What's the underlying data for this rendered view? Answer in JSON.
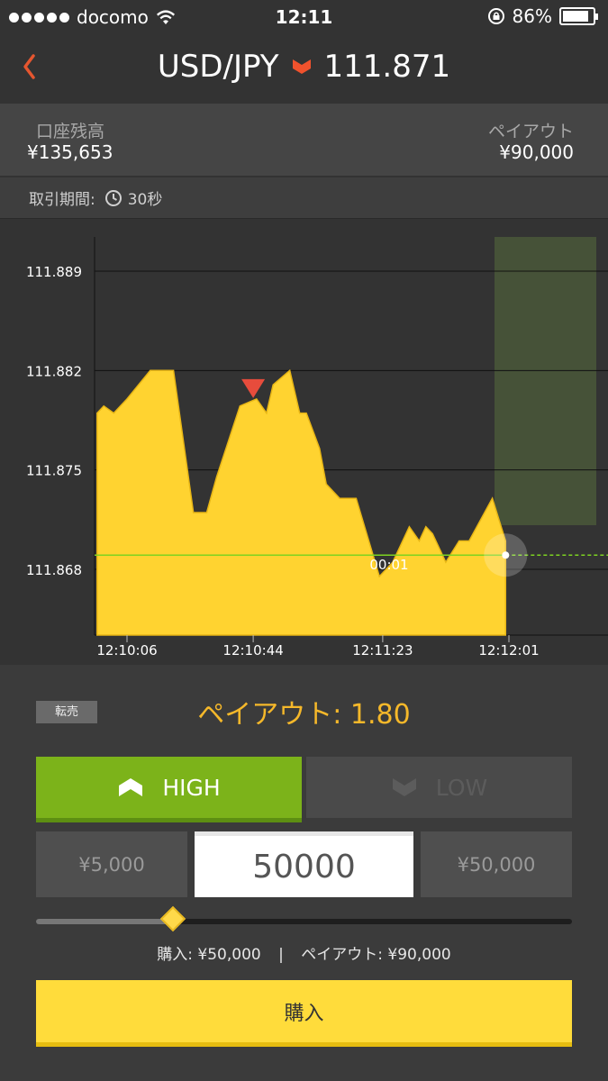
{
  "status_bar": {
    "carrier": "docomo",
    "time": "12:11",
    "battery": "86%",
    "battery_level": 0.86
  },
  "header": {
    "pair": "USD/JPY",
    "price": "111.871",
    "direction": "down",
    "direction_color": "#f0522d"
  },
  "account": {
    "balance_label": "口座残高",
    "balance_value": "¥135,653",
    "payout_label": "ペイアウト",
    "payout_value": "¥90,000"
  },
  "period": {
    "label": "取引期間:",
    "value": "30秒"
  },
  "chart_data": {
    "type": "area",
    "y_ticks": [
      "111.889",
      "111.882",
      "111.875",
      "111.868"
    ],
    "x_ticks": [
      "12:10:06",
      "12:10:44",
      "12:11:23",
      "12:12:01"
    ],
    "ylim": [
      111.8635,
      111.8905
    ],
    "x": [
      "12:09:57",
      "12:09:59",
      "12:10:02",
      "12:10:04",
      "12:10:06",
      "12:10:13",
      "12:10:15",
      "12:10:20",
      "12:10:26",
      "12:10:30",
      "12:10:33",
      "12:10:40",
      "12:10:45",
      "12:10:48",
      "12:10:50",
      "12:10:55",
      "12:10:58",
      "12:11:00",
      "12:11:04",
      "12:11:06",
      "12:11:10",
      "12:11:12",
      "12:11:15",
      "12:11:22",
      "12:11:26",
      "12:11:31",
      "12:11:34",
      "12:11:36",
      "12:11:38",
      "12:11:42",
      "12:11:46",
      "12:11:49",
      "12:11:56",
      "12:12:00"
    ],
    "values": [
      111.879,
      111.8795,
      111.879,
      111.8795,
      111.88,
      111.882,
      111.882,
      111.882,
      111.872,
      111.872,
      111.8745,
      111.8795,
      111.88,
      111.879,
      111.881,
      111.882,
      111.879,
      111.879,
      111.8765,
      111.874,
      111.873,
      111.873,
      111.873,
      111.8675,
      111.8685,
      111.871,
      111.87,
      111.871,
      111.8705,
      111.8685,
      111.87,
      111.87,
      111.873,
      111.87
    ],
    "strike": 111.869,
    "expiry_label": "00:01",
    "entry_marker_x": "12:10:44",
    "entry_marker_value": 111.88,
    "area_color": "#ffd330",
    "marker_color": "#e74c3c",
    "strike_color": "#7ed321",
    "expiry_zone_color": "#465238"
  },
  "panel": {
    "resale_label": "転売",
    "payout_rate": "ペイアウト: 1.80",
    "high_label": "HIGH",
    "low_label": "LOW",
    "min_amount": "¥5,000",
    "amount": "50000",
    "max_amount": "¥50,000",
    "slider_level": 0.255,
    "summary_purchase": "購入: ¥50,000",
    "summary_sep": "|",
    "summary_payout": "ペイアウト: ¥90,000",
    "buy_label": "購入",
    "high_color": "#7cb31a",
    "buy_color": "#ffdc3b"
  }
}
